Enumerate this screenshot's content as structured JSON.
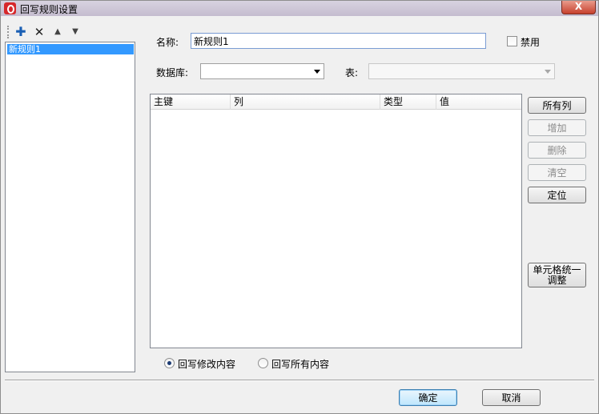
{
  "window": {
    "title": "回写规则设置",
    "close_label": "X"
  },
  "toolbar": {
    "add_glyph": "✚",
    "delete_glyph": "✕",
    "up_glyph": "▲",
    "down_glyph": "▼"
  },
  "rules": {
    "items": [
      {
        "label": "新规则1",
        "selected": true
      }
    ]
  },
  "form": {
    "name_label": "名称:",
    "name_value": "新规则1",
    "disable_label": "禁用",
    "disable_checked": false,
    "database_label": "数据库:",
    "database_value": "",
    "table_label": "表:",
    "table_value": ""
  },
  "grid": {
    "columns": [
      "主键",
      "列",
      "类型",
      "值"
    ],
    "rows": []
  },
  "side_buttons": {
    "all_columns": "所有列",
    "add": "增加",
    "delete": "删除",
    "clear": "清空",
    "locate": "定位",
    "unify_line1": "单元格统一",
    "unify_line2": "调整"
  },
  "mode": {
    "option_modified": "回写修改内容",
    "option_all": "回写所有内容",
    "selected": "modified"
  },
  "footer": {
    "ok": "确定",
    "cancel": "取消"
  },
  "colors": {
    "selection": "#3399ff",
    "close_button": "#c7412d"
  }
}
